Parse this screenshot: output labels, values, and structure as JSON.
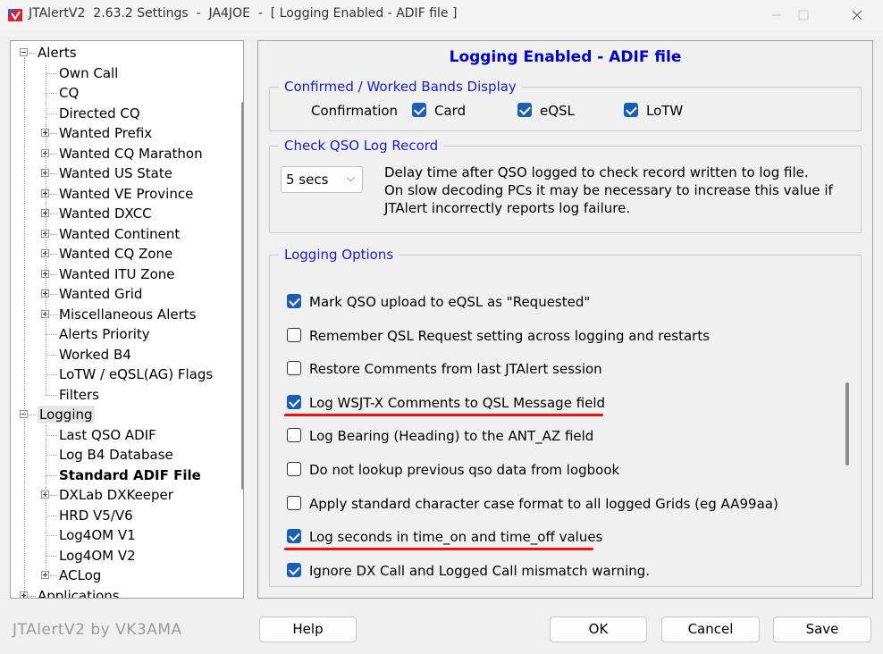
{
  "window": {
    "title": "JTAlertV2  2.63.2 Settings  -  JA4JOE  -  [ Logging Enabled - ADIF file ]",
    "controls": [
      "minimize",
      "maximize",
      "close"
    ]
  },
  "tree": {
    "items": [
      {
        "label": "Alerts",
        "level": 0,
        "expander": "minus"
      },
      {
        "label": "Own Call",
        "level": 1,
        "expander": "none"
      },
      {
        "label": "CQ",
        "level": 1,
        "expander": "none"
      },
      {
        "label": "Directed CQ",
        "level": 1,
        "expander": "none"
      },
      {
        "label": "Wanted Prefix",
        "level": 1,
        "expander": "plus"
      },
      {
        "label": "Wanted CQ Marathon",
        "level": 1,
        "expander": "plus"
      },
      {
        "label": "Wanted US State",
        "level": 1,
        "expander": "plus"
      },
      {
        "label": "Wanted VE Province",
        "level": 1,
        "expander": "plus"
      },
      {
        "label": "Wanted DXCC",
        "level": 1,
        "expander": "plus"
      },
      {
        "label": "Wanted Continent",
        "level": 1,
        "expander": "plus"
      },
      {
        "label": "Wanted CQ Zone",
        "level": 1,
        "expander": "plus"
      },
      {
        "label": "Wanted ITU Zone",
        "level": 1,
        "expander": "plus"
      },
      {
        "label": "Wanted Grid",
        "level": 1,
        "expander": "plus"
      },
      {
        "label": "Miscellaneous Alerts",
        "level": 1,
        "expander": "plus"
      },
      {
        "label": "Alerts Priority",
        "level": 1,
        "expander": "none"
      },
      {
        "label": "Worked B4",
        "level": 1,
        "expander": "none"
      },
      {
        "label": "LoTW / eQSL(AG) Flags",
        "level": 1,
        "expander": "none"
      },
      {
        "label": "Filters",
        "level": 1,
        "expander": "none"
      },
      {
        "label": "Logging",
        "level": 0,
        "expander": "minus",
        "highlight": true
      },
      {
        "label": "Last QSO ADIF",
        "level": 1,
        "expander": "none"
      },
      {
        "label": "Log B4 Database",
        "level": 1,
        "expander": "none"
      },
      {
        "label": "Standard ADIF File",
        "level": 1,
        "expander": "none",
        "selected": true
      },
      {
        "label": "DXLab DXKeeper",
        "level": 1,
        "expander": "plus"
      },
      {
        "label": "HRD V5/V6",
        "level": 1,
        "expander": "none"
      },
      {
        "label": "Log4OM V1",
        "level": 1,
        "expander": "none"
      },
      {
        "label": "Log4OM V2",
        "level": 1,
        "expander": "none"
      },
      {
        "label": "ACLog",
        "level": 1,
        "expander": "plus"
      },
      {
        "label": "Applications",
        "level": 0,
        "expander": "plus"
      }
    ]
  },
  "panel": {
    "title": "Logging Enabled - ADIF file",
    "bands_group": {
      "legend": "Confirmed / Worked Bands Display",
      "confirmation_label": "Confirmation",
      "options": [
        {
          "label": "Card",
          "checked": true
        },
        {
          "label": "eQSL",
          "checked": true
        },
        {
          "label": "LoTW",
          "checked": true
        }
      ]
    },
    "check_group": {
      "legend": "Check QSO Log Record",
      "delay_value": "5 secs",
      "description": [
        "Delay time after QSO logged to check record written to log file.",
        "On slow decoding PCs it may be necessary to increase this value if",
        "JTAlert incorrectly reports log failure."
      ]
    },
    "logging_group": {
      "legend": "Logging Options",
      "options": [
        {
          "label": "Mark QSO upload to eQSL as \"Requested\"",
          "checked": true,
          "underlined": false
        },
        {
          "label": "Remember QSL Request setting across logging and restarts",
          "checked": false,
          "underlined": false
        },
        {
          "label": "Restore Comments from last JTAlert session",
          "checked": false,
          "underlined": false
        },
        {
          "label": "Log WSJT-X Comments to QSL Message field",
          "checked": true,
          "underlined": true
        },
        {
          "label": "Log Bearing (Heading) to the ANT_AZ field",
          "checked": false,
          "underlined": false
        },
        {
          "label": "Do not lookup previous qso data from logbook",
          "checked": false,
          "underlined": false
        },
        {
          "label": "Apply standard character case format to all logged Grids (eg AA99aa)",
          "checked": false,
          "underlined": false
        },
        {
          "label": "Log seconds in time_on and time_off values",
          "checked": true,
          "underlined": true
        },
        {
          "label": "Ignore DX Call and Logged Call mismatch warning.",
          "checked": true,
          "underlined": false
        }
      ]
    }
  },
  "footer": {
    "brand": "JTAlertV2 by VK3AMA",
    "help": "Help",
    "ok": "OK",
    "cancel": "Cancel",
    "save": "Save"
  },
  "colors": {
    "accent_blue": "#1a5fb4",
    "title_blue": "#0000cc",
    "legend_blue": "#1a1ad6",
    "annotation_red": "#e11"
  }
}
